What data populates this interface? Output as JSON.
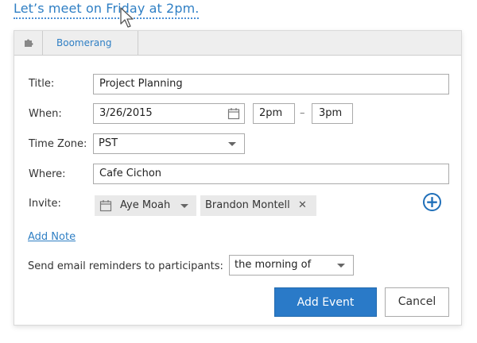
{
  "headline": "Let’s meet on Friday at 2pm.",
  "tabs": {
    "boomerang_label": "Boomerang"
  },
  "form": {
    "title_label": "Title:",
    "title_value": "Project Planning",
    "when_label": "When:",
    "date_value": "3/26/2015",
    "start_time": "2pm",
    "time_separator": "–",
    "end_time": "3pm",
    "timezone_label": "Time Zone:",
    "timezone_value": "PST",
    "where_label": "Where:",
    "where_value": "Cafe Cichon",
    "invite_label": "Invite:",
    "invitees": [
      "Aye Moah",
      "Brandon Montell"
    ],
    "add_note": "Add Note",
    "reminder_label": "Send email reminders to participants:",
    "reminder_value": "the morning of"
  },
  "actions": {
    "add_event": "Add Event",
    "cancel": "Cancel"
  },
  "colors": {
    "accent": "#2a7ac8",
    "link": "#2f7fc4"
  },
  "icons": [
    "cursor-icon",
    "puzzle-icon",
    "calendar-icon",
    "chevron-down-icon",
    "close-icon",
    "add-circle-icon"
  ]
}
